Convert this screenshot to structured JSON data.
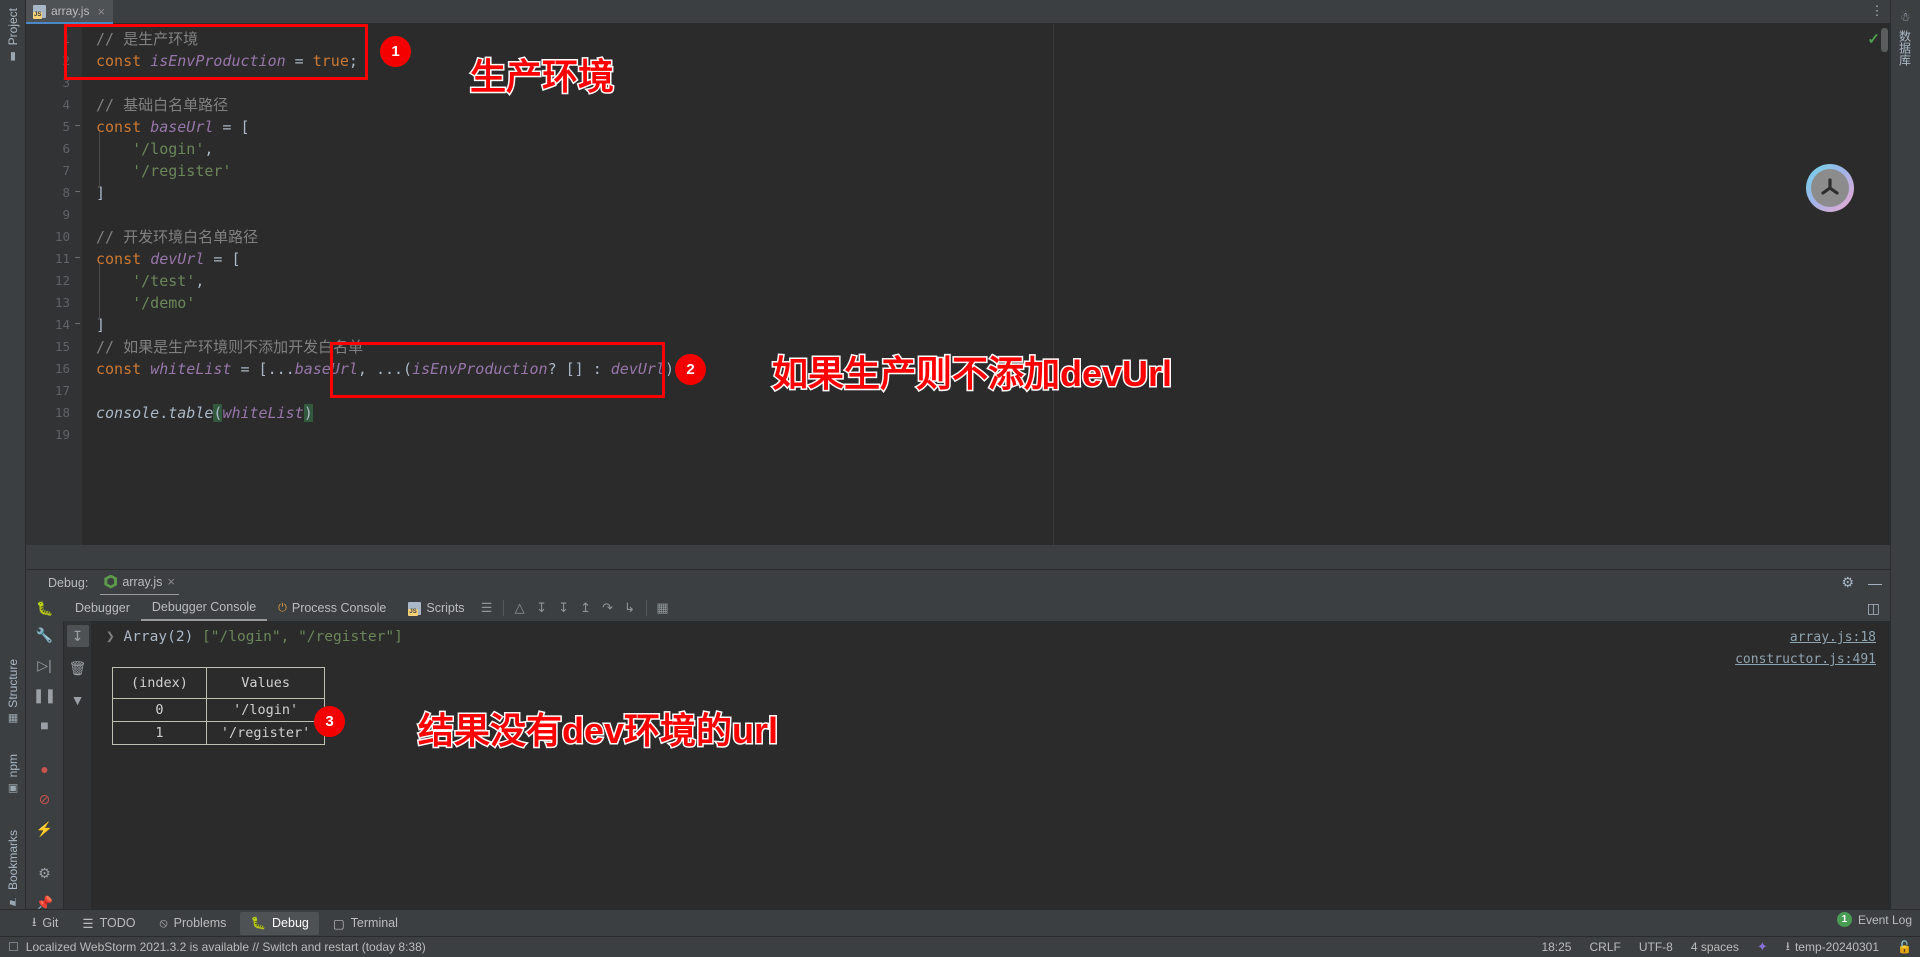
{
  "window": {
    "left_rail_labels": [
      "Project",
      "Structure",
      "npm",
      "Bookmarks"
    ],
    "right_rail_label": "数据库"
  },
  "editor": {
    "tab": {
      "label": "array.js",
      "icon": "js-file-icon",
      "close": "×"
    },
    "more_icon": "vertical-dots-icon",
    "inspection_ok_icon": "checkmark-icon",
    "lines": [
      {
        "n": 1,
        "fold": "",
        "tokens": [
          {
            "t": "// 是生产环境",
            "c": "cmt"
          }
        ]
      },
      {
        "n": 2,
        "fold": "",
        "tokens": [
          {
            "t": "const ",
            "c": "kw"
          },
          {
            "t": "isEnvProduction",
            "c": "var"
          },
          {
            "t": " = ",
            "c": "pn"
          },
          {
            "t": "true",
            "c": "kw"
          },
          {
            "t": ";",
            "c": "pn"
          }
        ]
      },
      {
        "n": 3,
        "fold": "",
        "tokens": []
      },
      {
        "n": 4,
        "fold": "",
        "tokens": [
          {
            "t": "// 基础白名单路径",
            "c": "cmt"
          }
        ]
      },
      {
        "n": 5,
        "fold": "−",
        "tokens": [
          {
            "t": "const ",
            "c": "kw"
          },
          {
            "t": "baseUrl",
            "c": "var"
          },
          {
            "t": " = [",
            "c": "pn"
          }
        ]
      },
      {
        "n": 6,
        "fold": "",
        "tokens": [
          {
            "t": "    '/login'",
            "c": "str"
          },
          {
            "t": ",",
            "c": "pn"
          }
        ]
      },
      {
        "n": 7,
        "fold": "",
        "tokens": [
          {
            "t": "    '/register'",
            "c": "str"
          }
        ]
      },
      {
        "n": 8,
        "fold": "−",
        "tokens": [
          {
            "t": "]",
            "c": "pn"
          }
        ]
      },
      {
        "n": 9,
        "fold": "",
        "tokens": []
      },
      {
        "n": 10,
        "fold": "",
        "tokens": [
          {
            "t": "// 开发环境白名单路径",
            "c": "cmt"
          }
        ]
      },
      {
        "n": 11,
        "fold": "−",
        "tokens": [
          {
            "t": "const ",
            "c": "kw"
          },
          {
            "t": "devUrl",
            "c": "var"
          },
          {
            "t": " = [",
            "c": "pn"
          }
        ]
      },
      {
        "n": 12,
        "fold": "",
        "tokens": [
          {
            "t": "    '/test'",
            "c": "str"
          },
          {
            "t": ",",
            "c": "pn"
          }
        ]
      },
      {
        "n": 13,
        "fold": "",
        "tokens": [
          {
            "t": "    '/demo'",
            "c": "str"
          }
        ]
      },
      {
        "n": 14,
        "fold": "−",
        "tokens": [
          {
            "t": "]",
            "c": "pn"
          }
        ]
      },
      {
        "n": 15,
        "fold": "",
        "tokens": [
          {
            "t": "// 如果是生产环境则不添加开发白名单",
            "c": "cmt"
          }
        ]
      },
      {
        "n": 16,
        "fold": "",
        "tokens": [
          {
            "t": "const ",
            "c": "kw"
          },
          {
            "t": "whiteList",
            "c": "var"
          },
          {
            "t": " = [...",
            "c": "pn"
          },
          {
            "t": "baseUrl",
            "c": "var"
          },
          {
            "t": ", ...(",
            "c": "pn"
          },
          {
            "t": "isEnvProduction",
            "c": "var"
          },
          {
            "t": "? [] : ",
            "c": "pn"
          },
          {
            "t": "devUrl",
            "c": "var"
          },
          {
            "t": ")];",
            "c": "pn"
          }
        ]
      },
      {
        "n": 17,
        "fold": "",
        "tokens": []
      },
      {
        "n": 18,
        "fold": "",
        "tokens": [
          {
            "t": "console",
            "c": "blockfn"
          },
          {
            "t": ".",
            "c": "pn"
          },
          {
            "t": "table",
            "c": "blockfn"
          },
          {
            "t": "(",
            "c": "hl"
          },
          {
            "t": "whiteList",
            "c": "var"
          },
          {
            "t": ")",
            "c": "hl"
          }
        ]
      },
      {
        "n": 19,
        "fold": "",
        "tokens": []
      }
    ]
  },
  "debug": {
    "header_label": "Debug:",
    "session_tab": "array.js",
    "session_close": "×",
    "settings_icon": "gear-icon",
    "minimize_icon": "minimize-icon",
    "bug_icon": "bug-icon",
    "tabs": [
      {
        "label": "Debugger",
        "active": false,
        "icon": ""
      },
      {
        "label": "Debugger Console",
        "active": true,
        "icon": ""
      },
      {
        "label": "Process Console",
        "active": false,
        "icon": "power-icon"
      },
      {
        "label": "Scripts",
        "active": false,
        "icon": "js-file-icon"
      }
    ],
    "toolbar_icons": [
      "soft-wrap-icon",
      "resume-icon",
      "step-over-icon",
      "step-into-icon",
      "step-out-icon",
      "run-to-cursor-icon",
      "evaluate-icon",
      "console-table-icon"
    ],
    "rail_icons": [
      "wrench-icon",
      "filter-down-icon",
      "trash-icon",
      "filter-icon",
      "mute-breakpoints-icon",
      "no-run-icon",
      "flash-icon",
      "settings-icon",
      "pin-icon"
    ],
    "rail2_icons": [
      "scroll-end-icon",
      "trash-icon",
      "filter-icon"
    ],
    "console": {
      "output_line": "Array(2) [\"/login\", \"/register\"]",
      "expand_arrow": "❯",
      "array_prefix": "Array(2) ",
      "array_body": "[\"/login\", \"/register\"]",
      "links": [
        "array.js:18",
        "constructor.js:491"
      ],
      "table": {
        "headers": [
          "(index)",
          "Values"
        ],
        "rows": [
          {
            "index": "0",
            "value": "'/login'"
          },
          {
            "index": "1",
            "value": "'/register'"
          }
        ]
      }
    },
    "right_panel_icon": "layout-icon"
  },
  "annotations": [
    {
      "num": "1",
      "text": "生产环境"
    },
    {
      "num": "2",
      "text": "如果生产则不添加devUrl"
    },
    {
      "num": "3",
      "text": "结果没有dev环境的url"
    }
  ],
  "toolwindow_bar": [
    {
      "label": "Git",
      "icon": "branch-icon",
      "active": false
    },
    {
      "label": "TODO",
      "icon": "list-icon",
      "active": false
    },
    {
      "label": "Problems",
      "icon": "error-icon",
      "active": false
    },
    {
      "label": "Debug",
      "icon": "bug-icon",
      "active": true
    },
    {
      "label": "Terminal",
      "icon": "terminal-icon",
      "active": false
    }
  ],
  "status_bar": {
    "message_icon": "note-icon",
    "message": "Localized WebStorm 2021.3.2 is available // Switch and restart (today 8:38)",
    "position": "18:25",
    "line_sep": "CRLF",
    "encoding": "UTF-8",
    "indent": "4 spaces",
    "tool_icon": "tool-icon",
    "branch_icon": "branch-icon",
    "branch": "temp-20240301",
    "lock_icon": "unlock-icon"
  },
  "event_log": {
    "count": "1",
    "label": "Event Log"
  },
  "colors": {
    "annotation_red": "#ff0000",
    "badge_red": "#f50000",
    "accent_blue": "#4a88c7",
    "editor_bg": "#2b2b2b",
    "chrome_bg": "#3c3f41"
  }
}
